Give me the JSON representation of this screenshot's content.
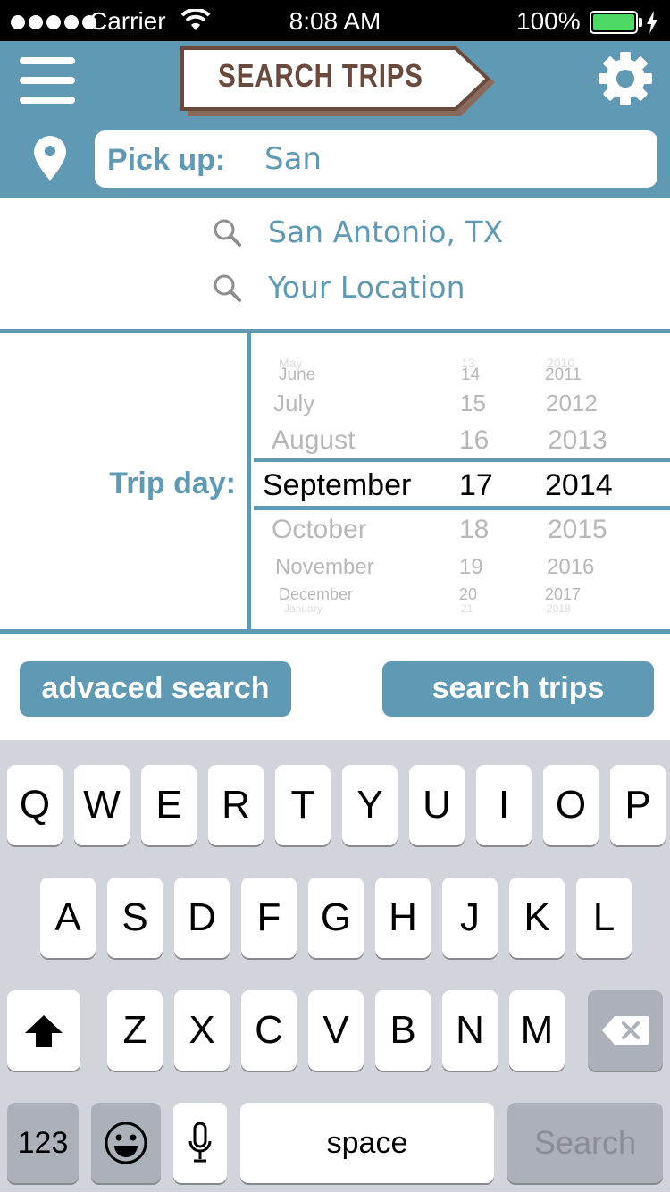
{
  "status_bar": {
    "carrier": "Carrier",
    "time": "8:08 AM",
    "battery": "100%"
  },
  "header": {
    "title": "SEARCH TRIPS",
    "pickup_label": "Pick up:",
    "pickup_value": "San"
  },
  "suggestions": [
    "San Antonio, TX",
    "Your Location"
  ],
  "trip_day": {
    "label": "Trip day:",
    "months": [
      "May",
      "June",
      "July",
      "August",
      "September",
      "October",
      "November",
      "December",
      "January"
    ],
    "days": [
      "13",
      "14",
      "15",
      "16",
      "17",
      "18",
      "19",
      "20",
      "21"
    ],
    "years": [
      "2010",
      "2011",
      "2012",
      "2013",
      "2014",
      "2015",
      "2016",
      "2017",
      "2018"
    ],
    "selected": {
      "month": "September",
      "day": "17",
      "year": "2014"
    }
  },
  "buttons": {
    "advanced": "advaced search",
    "search": "search trips"
  },
  "keyboard": {
    "row1": [
      "Q",
      "W",
      "E",
      "R",
      "T",
      "Y",
      "U",
      "I",
      "O",
      "P"
    ],
    "row2": [
      "A",
      "S",
      "D",
      "F",
      "G",
      "H",
      "J",
      "K",
      "L"
    ],
    "row3": [
      "Z",
      "X",
      "C",
      "V",
      "B",
      "N",
      "M"
    ],
    "numbers": "123",
    "space": "space",
    "action": "Search"
  },
  "colors": {
    "accent": "#5f99b4",
    "sign_text": "#6a4a3c",
    "keyboard_bg": "#d1d5db"
  }
}
